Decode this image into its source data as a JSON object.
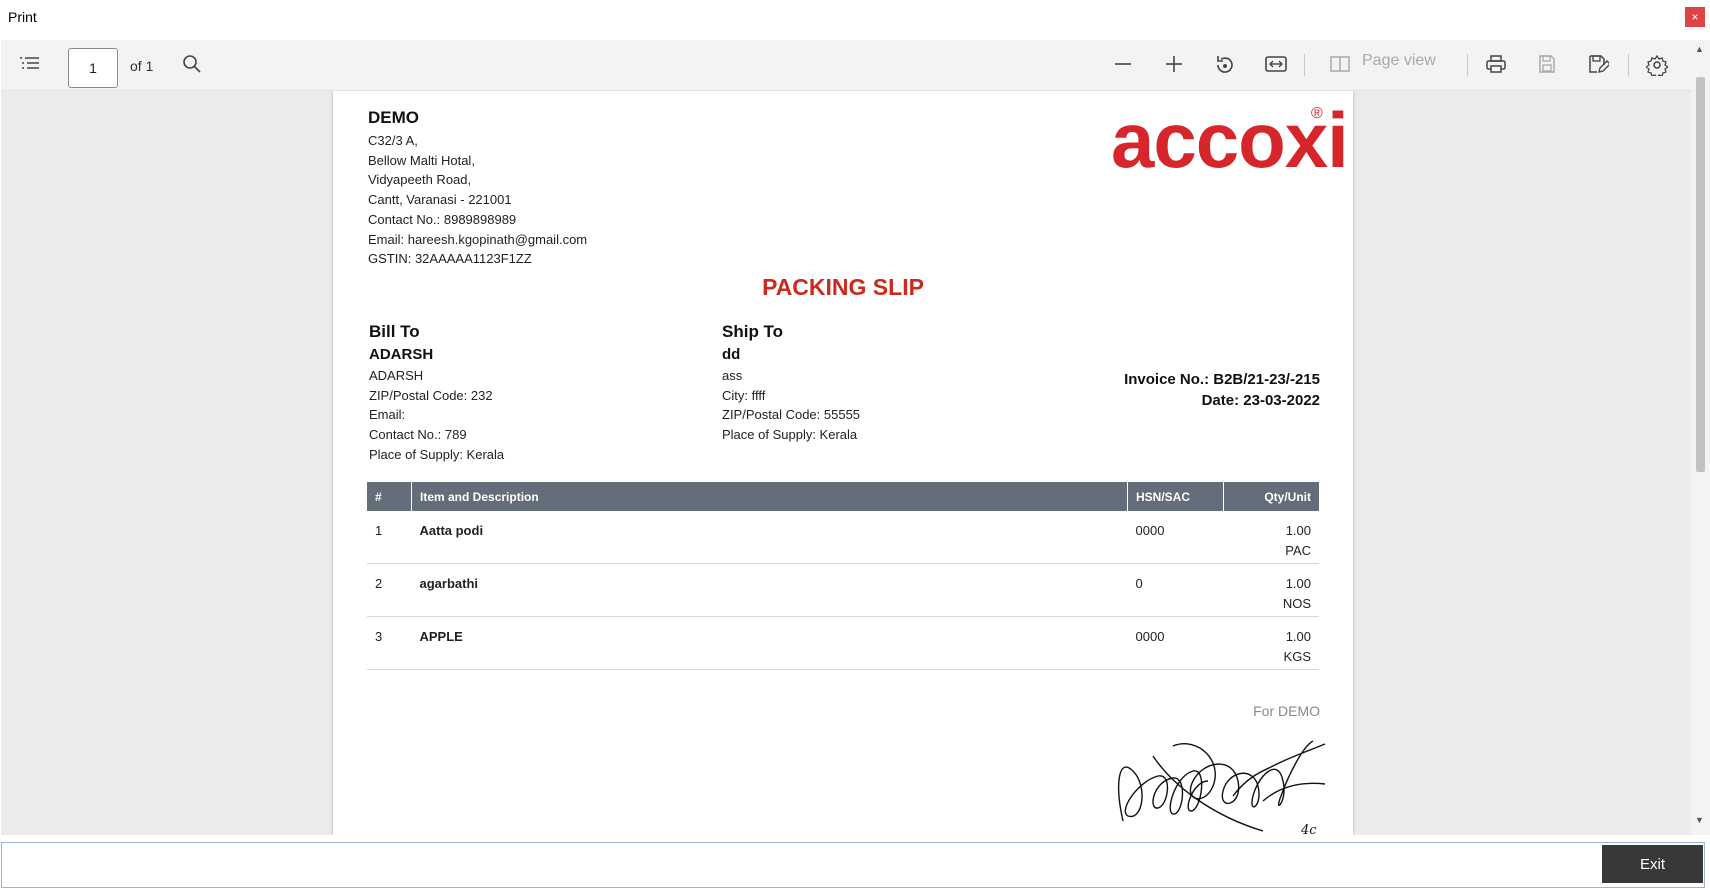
{
  "window": {
    "title": "Print",
    "close_glyph": "×"
  },
  "toolbar": {
    "page_number": "1",
    "page_of": "of 1",
    "page_view_label": "Page view",
    "icons": [
      "contents-list-icon",
      "search-icon",
      "zoom-out-icon",
      "zoom-in-icon",
      "rotate-icon",
      "fit-width-icon",
      "page-view-icon",
      "print-icon",
      "save-icon",
      "save-as-icon",
      "settings-icon"
    ]
  },
  "document": {
    "company": {
      "name": "DEMO",
      "address_lines": [
        "C32/3 A,",
        "Bellow Malti Hotal,",
        "Vidyapeeth Road,",
        "Cantt, Varanasi - 221001",
        "Contact No.: 8989898989",
        "Email: hareesh.kgopinath@gmail.com",
        "GSTIN: 32AAAAA1123F1ZZ"
      ]
    },
    "logo": {
      "text": "accoxi",
      "mark": "®",
      "color": "#d6262c"
    },
    "title": "PACKING SLIP",
    "title_color": "#cc2a1f",
    "bill_to": {
      "heading": "Bill To",
      "name": "ADARSH",
      "lines": [
        "ADARSH",
        "ZIP/Postal Code: 232",
        "Email:",
        "Contact No.: 789",
        "Place of Supply: Kerala"
      ]
    },
    "ship_to": {
      "heading": "Ship To",
      "name": "dd",
      "lines": [
        "ass",
        "City: ffff",
        "ZIP/Postal Code: 55555",
        "Place of Supply: Kerala"
      ]
    },
    "invoice": {
      "number_label": "Invoice No.: B2B/21-23/-215",
      "date_label": "Date: 23-03-2022"
    },
    "table": {
      "columns": [
        "#",
        "Item and Description",
        "HSN/SAC",
        "Qty/Unit"
      ],
      "header_color": "#636e7a",
      "rows": [
        {
          "no": "1",
          "item": "Aatta podi",
          "hsn": "0000",
          "qty": "1.00",
          "unit": "PAC"
        },
        {
          "no": "2",
          "item": "agarbathi",
          "hsn": "0",
          "qty": "1.00",
          "unit": "NOS"
        },
        {
          "no": "3",
          "item": "APPLE",
          "hsn": "0000",
          "qty": "1.00",
          "unit": "KGS"
        }
      ]
    },
    "for_label": "For DEMO",
    "signature_mark": "4c"
  },
  "footer": {
    "exit_label": "Exit"
  }
}
